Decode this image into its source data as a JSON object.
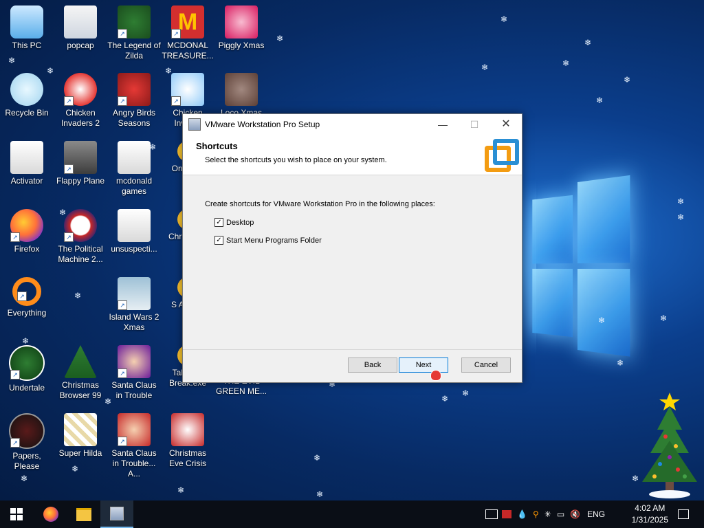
{
  "desktop": {
    "icons": [
      {
        "label": "This PC"
      },
      {
        "label": "popcap"
      },
      {
        "label": "The Legend of Zilda"
      },
      {
        "label": "MCDONAL TREASURE..."
      },
      {
        "label": "Piggly Xmas"
      },
      {
        "label": "Recycle Bin"
      },
      {
        "label": "Chicken Invaders 2"
      },
      {
        "label": "Angry Birds Seasons"
      },
      {
        "label": "Chicken Invad..."
      },
      {
        "label": "Loco Xmas"
      },
      {
        "label": "Activator"
      },
      {
        "label": "Flappy Plane"
      },
      {
        "label": "mcdonald games"
      },
      {
        "label": "Ornam..."
      },
      {
        "label": "Firefox"
      },
      {
        "label": "The Political Machine 2..."
      },
      {
        "label": "unsuspecti..."
      },
      {
        "label": "Chr Swe..."
      },
      {
        "label": "Everything"
      },
      {
        "label": "Island Wars 2 Xmas"
      },
      {
        "label": "S Anim..."
      },
      {
        "label": "Undertale"
      },
      {
        "label": "Christmas Browser 99"
      },
      {
        "label": "Santa Claus in Trouble"
      },
      {
        "label": "Taking a Break.exe"
      },
      {
        "label": "THE EVIL GREEN ME..."
      },
      {
        "label": "Papers, Please"
      },
      {
        "label": "Super Hilda"
      },
      {
        "label": "Santa Claus in Trouble... A..."
      },
      {
        "label": "Christmas Eve Crisis"
      }
    ]
  },
  "dialog": {
    "title": "VMware Workstation Pro Setup",
    "header_title": "Shortcuts",
    "header_subtitle": "Select the shortcuts you wish to place on your system.",
    "prompt": "Create shortcuts for VMware Workstation Pro in the following places:",
    "options": [
      {
        "label": "Desktop",
        "checked": true
      },
      {
        "label": "Start Menu Programs Folder",
        "checked": true
      }
    ],
    "buttons": {
      "back": "Back",
      "next": "Next",
      "cancel": "Cancel"
    },
    "minimize_glyph": "—",
    "maximize_glyph": "☐",
    "close_glyph": "✕",
    "check_glyph": "✓"
  },
  "taskbar": {
    "language": "ENG",
    "time": "4:02 AM",
    "date": "1/31/2025"
  }
}
